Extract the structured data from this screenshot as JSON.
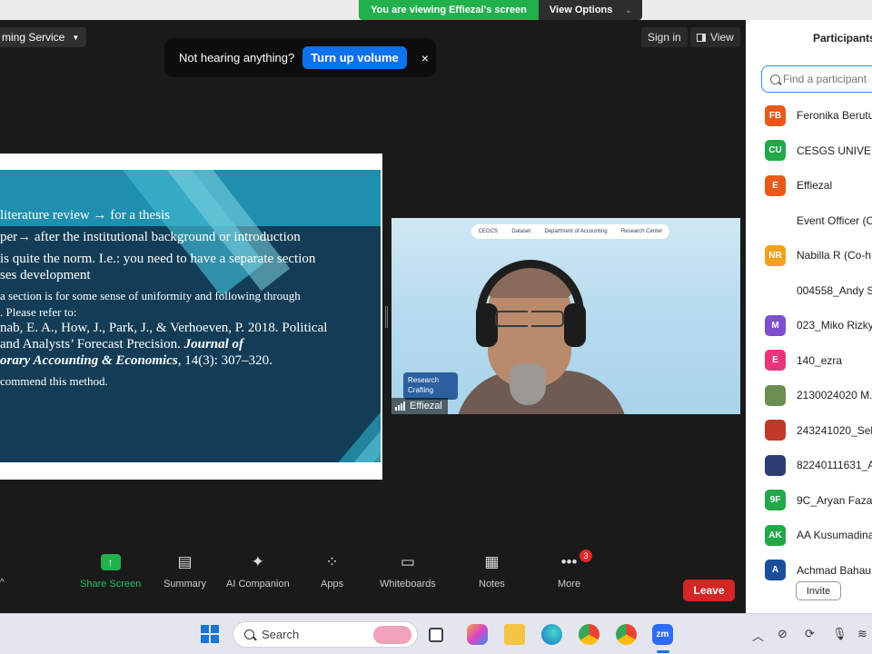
{
  "banner": {
    "viewing_text": "You are viewing Effiezal's screen",
    "view_options": "View Options"
  },
  "meeting": {
    "streaming_label": "ming Service",
    "sign_in": "Sign in",
    "view": "View",
    "toast": {
      "text": "Not hearing anything?",
      "button": "Turn up volume",
      "close": "×"
    }
  },
  "slide": {
    "lines": [
      "literature review → for a thesis",
      "per→ after the institutional background or introduction",
      "is quite the norm. I.e.: you need to have a separate section",
      "ses development",
      "a section is for some sense of uniformity and following through",
      ". Please refer to:",
      "nab, E. A., How, J., Park, J., & Verhoeven, P. 2018. Political",
      "and Analysts’ Forecast Precision.",
      "orary Accounting & Economics",
      "commend this method."
    ],
    "journal_prefix": "Journal of",
    "journal_suffix": ", 14(3): 307–320."
  },
  "video": {
    "participant_name": "Effiezal",
    "badge_line1": "Research",
    "badge_line2": "Crafting",
    "logos": [
      "CEGCS",
      "Dataset",
      "Department of Accounting",
      "Research Center"
    ]
  },
  "toolbar": {
    "share_screen": "Share Screen",
    "summary": "Summary",
    "ai_companion": "AI Companion",
    "apps": "Apps",
    "whiteboards": "Whiteboards",
    "notes": "Notes",
    "more": "More",
    "more_badge": "3",
    "leave": "Leave"
  },
  "participants": {
    "title": "Participants",
    "search_placeholder": "Find a participant",
    "invite": "Invite",
    "list": [
      {
        "initials": "FB",
        "name": "Feronika Berutu",
        "color": "#e8591c"
      },
      {
        "initials": "CU",
        "name": "CESGS UNIVER",
        "color": "#22a84a"
      },
      {
        "initials": "E",
        "name": "Effiezal",
        "color": "#e8591c"
      },
      {
        "initials": "",
        "name": "Event Officer (C",
        "color": "#ffffff"
      },
      {
        "initials": "NR",
        "name": "Nabilla R (Co-h",
        "color": "#f0a21c"
      },
      {
        "initials": "",
        "name": "004558_Andy S",
        "color": "#ffffff"
      },
      {
        "initials": "M",
        "name": "023_Miko Rizky",
        "color": "#7e4fcf"
      },
      {
        "initials": "E",
        "name": "140_ezra",
        "color": "#e8357a"
      },
      {
        "initials": "",
        "name": "2130024020 M.",
        "color": "#6b8f52"
      },
      {
        "initials": "",
        "name": "243241020_Self",
        "color": "#c0392b"
      },
      {
        "initials": "",
        "name": "82240111631_A",
        "color": "#2c3e70"
      },
      {
        "initials": "9F",
        "name": "9C_Aryan Faza",
        "color": "#22a84a"
      },
      {
        "initials": "AK",
        "name": "AA Kusumadina",
        "color": "#22a84a"
      },
      {
        "initials": "A",
        "name": "Achmad Bahau",
        "color": "#1b4f9c"
      }
    ]
  },
  "taskbar": {
    "search": "Search",
    "zoom_label": "zm"
  }
}
